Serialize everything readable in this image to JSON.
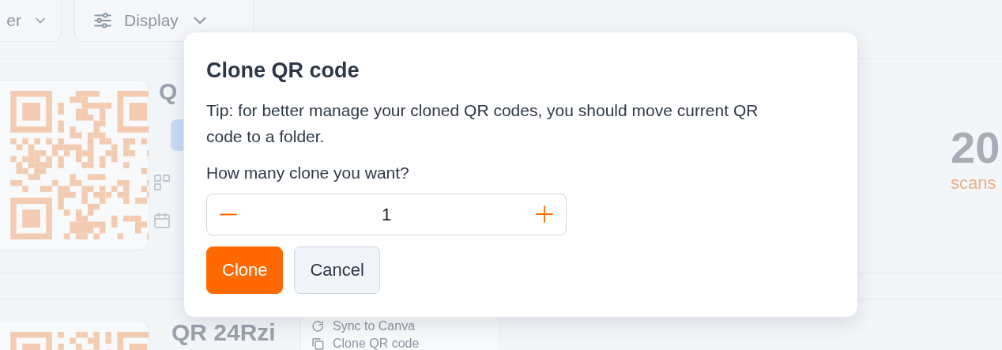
{
  "toolbar": {
    "buttons": [
      {
        "label": "er",
        "kind": "filter"
      },
      {
        "label": "Display",
        "kind": "display"
      }
    ]
  },
  "cards": [
    {
      "title": "Q",
      "stat_value": "20",
      "stat_label": "scans"
    },
    {
      "title": "QR 24Rzi"
    }
  ],
  "menu": {
    "items": [
      {
        "label": "Sync to Canva",
        "kind": "sync"
      },
      {
        "label": "Clone QR code",
        "kind": "clone"
      }
    ]
  },
  "modal": {
    "title": "Clone QR code",
    "tip": "Tip: for better manage your cloned QR codes, you should move current QR code to a folder.",
    "question": "How many clone you want?",
    "quantity": "1",
    "buttons": [
      {
        "label": "Clone",
        "kind": "primary"
      },
      {
        "label": "Cancel",
        "kind": "secondary"
      }
    ]
  }
}
